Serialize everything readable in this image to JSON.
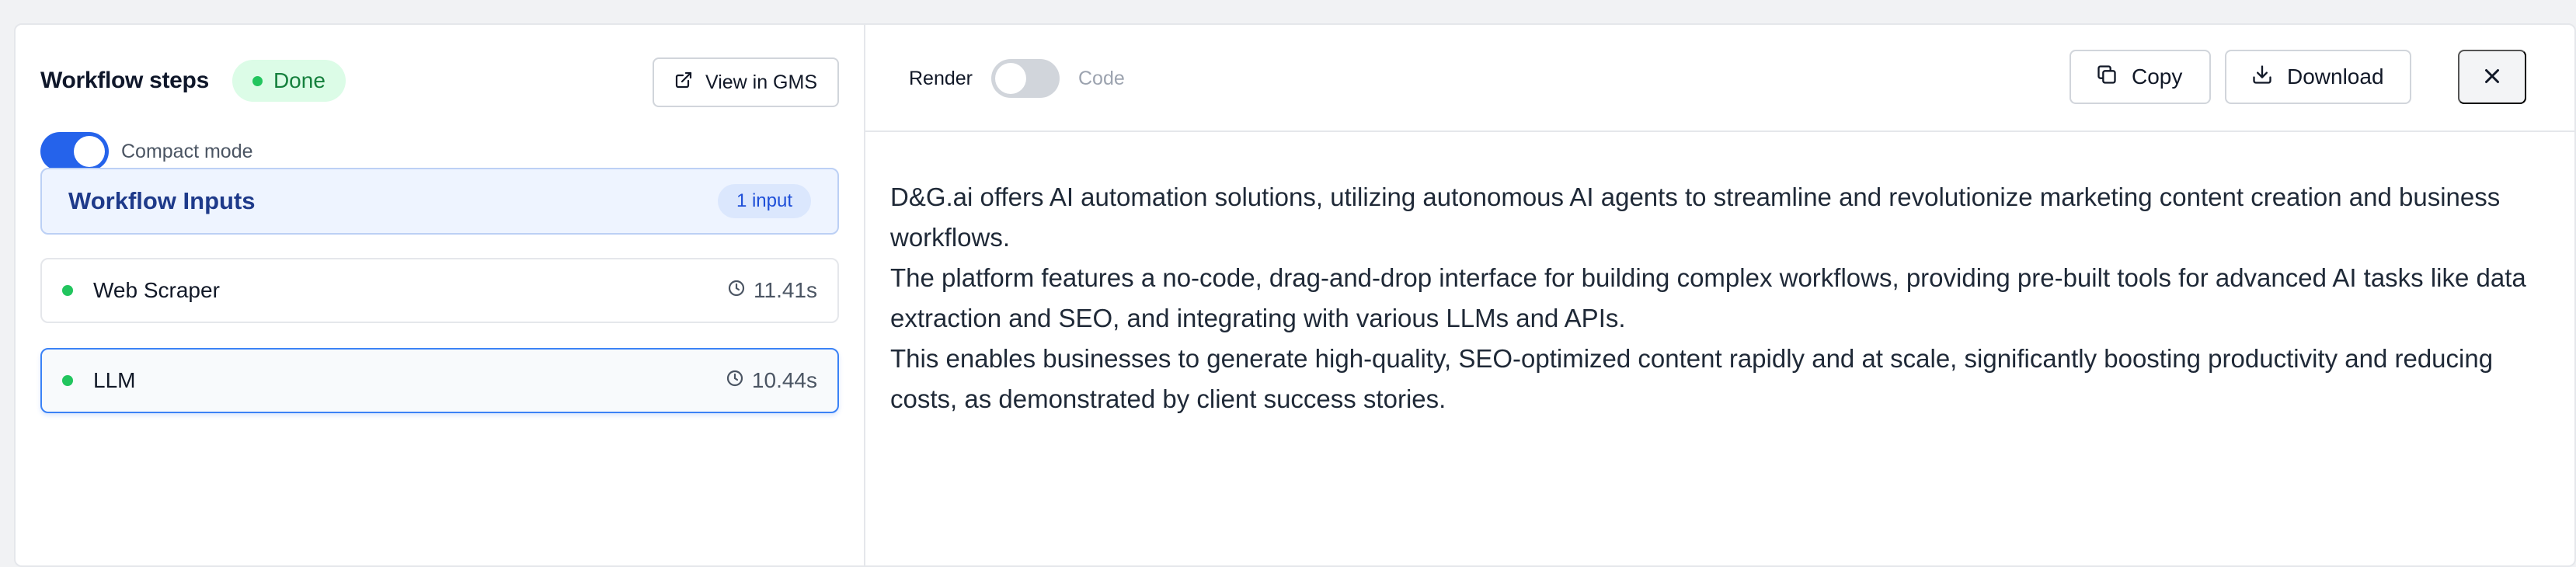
{
  "left_panel": {
    "title": "Workflow steps",
    "status": "Done",
    "view_button": "View in GMS",
    "compact_mode": {
      "label": "Compact mode",
      "enabled": true
    },
    "inputs": {
      "title": "Workflow Inputs",
      "badge": "1 input"
    },
    "steps": [
      {
        "name": "Web Scraper",
        "time": "11.41s",
        "status": "done",
        "active": false
      },
      {
        "name": "LLM",
        "time": "10.44s",
        "status": "done",
        "active": true
      }
    ]
  },
  "right_panel": {
    "render_label": "Render",
    "code_label": "Code",
    "render_toggle_on": false,
    "copy_label": "Copy",
    "download_label": "Download",
    "paragraphs": [
      "D&G.ai offers AI automation solutions, utilizing autonomous AI agents to streamline and revolutionize marketing content creation and business workflows.",
      "The platform features a no-code, drag-and-drop interface for building complex workflows, providing pre-built tools for advanced AI tasks like data extraction and SEO, and integrating with various LLMs and APIs.",
      "This enables businesses to generate high-quality, SEO-optimized content rapidly and at scale, significantly boosting productivity and reducing costs, as demonstrated by client success stories."
    ]
  },
  "colors": {
    "accent": "#2563eb",
    "success": "#22c55e",
    "inputs_bg": "#eef4ff"
  },
  "icons": [
    "external-link-icon",
    "clock-icon",
    "copy-icon",
    "download-icon",
    "close-icon"
  ]
}
